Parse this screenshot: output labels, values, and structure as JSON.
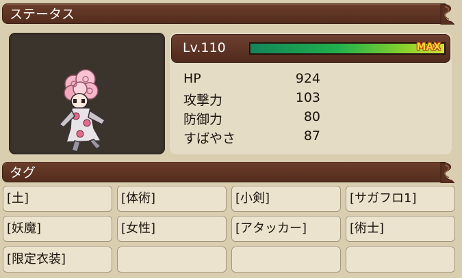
{
  "header": {
    "title": "ステータス"
  },
  "level": {
    "label": "Lv.110",
    "exp_fraction": 1.0,
    "exp_status": "MAX"
  },
  "stats": [
    {
      "name": "HP",
      "value": "924"
    },
    {
      "name": "攻撃力",
      "value": "103"
    },
    {
      "name": "防御力",
      "value": "80"
    },
    {
      "name": "すばやさ",
      "value": "87"
    }
  ],
  "tags_header": {
    "title": "タグ"
  },
  "tags": [
    "[土]",
    "[体術]",
    "[小剣]",
    "[サガフロ1]",
    "[妖魔]",
    "[女性]",
    "[アタッカー]",
    "[術士]",
    "[限定衣装]",
    "",
    "",
    ""
  ],
  "colors": {
    "banner": "#5e3424",
    "panel": "#d9ceb0",
    "exp_max_text": "#ffd23a"
  }
}
